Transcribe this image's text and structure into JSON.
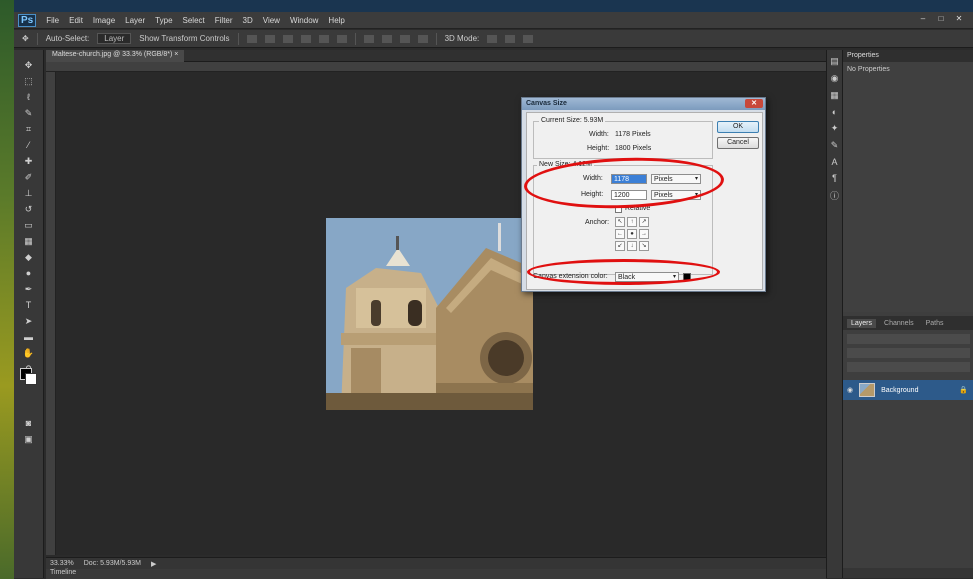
{
  "app": {
    "logo": "Ps",
    "menu": [
      "File",
      "Edit",
      "Image",
      "Layer",
      "Type",
      "Select",
      "Filter",
      "3D",
      "View",
      "Window",
      "Help"
    ],
    "window_controls": [
      "–",
      "□",
      "✕"
    ]
  },
  "options_bar": {
    "items": [
      "Transform",
      "Auto-Select:",
      "Layer",
      "Show Transform Controls",
      "3D Mode:"
    ]
  },
  "document": {
    "tab_label": "Maltese-church.jpg @ 33.3% (RGB/8*) ×",
    "zoom": "33.33%",
    "doc_info": "Doc: 5.93M/5.93M",
    "timeline_label": "Timeline"
  },
  "dialog": {
    "title": "Canvas Size",
    "current_size": "Current Size: 5.93M",
    "current_width_label": "Width:",
    "current_width_value": "1178 Pixels",
    "current_height_label": "Height:",
    "current_height_value": "1800 Pixels",
    "new_size": "New Size: 4.12M",
    "width_label": "Width:",
    "width_value": "1178",
    "width_unit": "Pixels",
    "height_label": "Height:",
    "height_value": "1200",
    "height_unit": "Pixels",
    "relative_label": "Relative",
    "anchor_label": "Anchor:",
    "anchor_arrows": [
      "↖",
      "↑",
      "↗",
      "←",
      "●",
      "→",
      "↙",
      "↓",
      "↘"
    ],
    "ok_label": "OK",
    "cancel_label": "Cancel",
    "extension_label": "Canvas extension color:",
    "extension_value": "Black",
    "close_label": "✕"
  },
  "panels": {
    "properties_title": "Properties",
    "properties_body": "No Properties",
    "layer_tabs": [
      "Layers",
      "Channels",
      "Paths"
    ],
    "layer_name": "Background",
    "layer_lock": "🔒"
  },
  "colors": {
    "annotation": "#e01010",
    "selection": "#2d5a8a"
  }
}
